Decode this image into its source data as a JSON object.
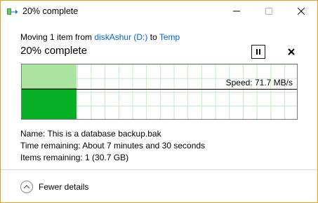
{
  "window": {
    "title": "20% complete"
  },
  "operation": {
    "prefix": "Moving 1 item from",
    "source": "diskAshur (D:)",
    "connector": "to",
    "destination": "Temp"
  },
  "progress": {
    "heading": "20% complete",
    "percent": 20,
    "speed_label": "Speed: 71.7 MB/s"
  },
  "details": {
    "name_label": "Name:",
    "name_value": "This is a database backup.bak",
    "time_label": "Time remaining:",
    "time_value": "About 7 minutes and 30 seconds",
    "items_label": "Items remaining:",
    "items_value": "1 (30.7 GB)"
  },
  "footer": {
    "fewer_details_label": "Fewer details"
  },
  "colors": {
    "progress_light": "#abe5a0",
    "progress_dark": "#06b025",
    "link": "#0066cc",
    "window_border": "#e6a020"
  },
  "icons": {
    "title": "file-move-icon",
    "minimize": "minimize-icon",
    "maximize": "maximize-icon",
    "close": "close-icon",
    "pause": "pause-icon",
    "cancel": "close-icon",
    "fewer": "chevron-up-icon"
  }
}
